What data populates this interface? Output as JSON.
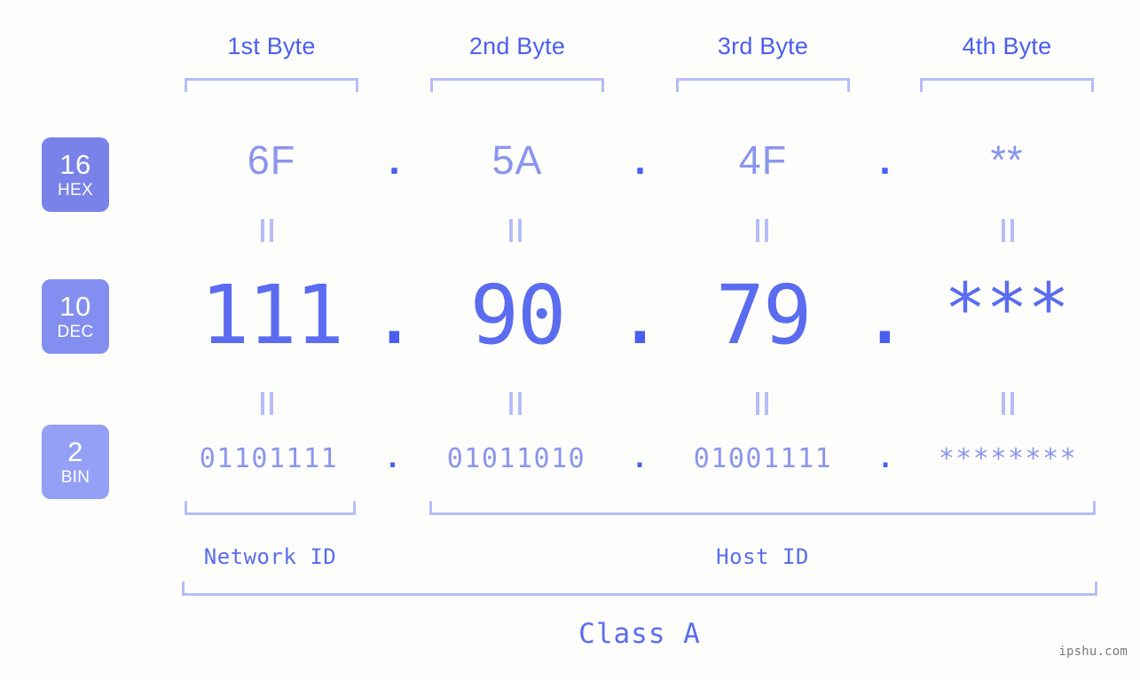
{
  "background_color": "#fdfefb",
  "accent_color": "#4a5ef0",
  "muted_accent_color": "#8b95ef",
  "bracket_color": "#b6bdf9",
  "header": {
    "byte_labels": [
      {
        "label": "1st Byte"
      },
      {
        "label": "2nd Byte"
      },
      {
        "label": "3rd Byte"
      },
      {
        "label": "4th Byte"
      }
    ]
  },
  "bases": [
    {
      "id": "hex",
      "number": "16",
      "name": "HEX",
      "color": "#7882e8"
    },
    {
      "id": "dec",
      "number": "10",
      "name": "DEC",
      "color": "#838ff0"
    },
    {
      "id": "bin",
      "number": "2",
      "name": "BIN",
      "color": "#93a0f6"
    }
  ],
  "separator": ".",
  "rows": {
    "hex": {
      "values": [
        "6F",
        "5A",
        "4F",
        "**"
      ]
    },
    "dec": {
      "values": [
        "111",
        "90",
        "79",
        "***"
      ]
    },
    "bin": {
      "values": [
        "01101111",
        "01011010",
        "01001111",
        "********"
      ]
    }
  },
  "sections": {
    "network_id": "Network ID",
    "host_id": "Host ID",
    "class": "Class A"
  },
  "watermark": "ipshu.com"
}
